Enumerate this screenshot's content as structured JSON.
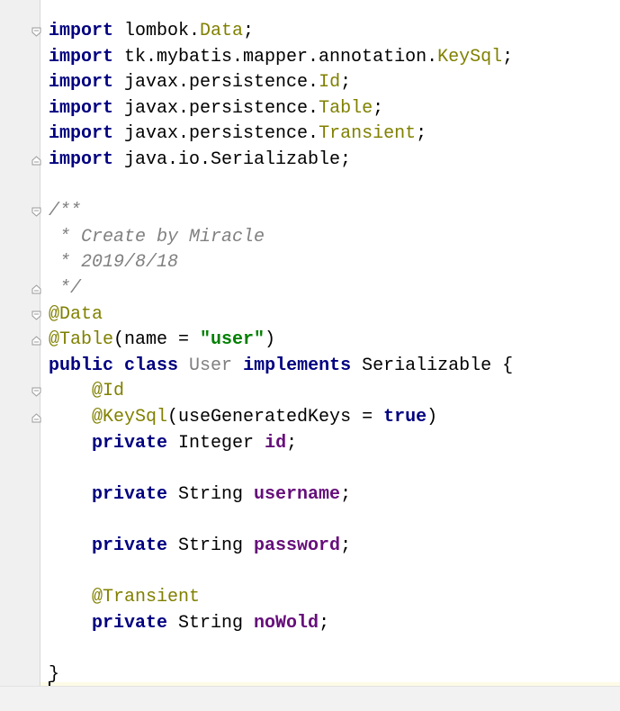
{
  "editor": {
    "lines": [
      [
        {
          "t": "import",
          "c": "kw"
        },
        {
          "t": " lombok."
        },
        {
          "t": "Data",
          "c": "cls"
        },
        {
          "t": ";"
        }
      ],
      [
        {
          "t": "import",
          "c": "kw"
        },
        {
          "t": " tk.mybatis.mapper.annotation."
        },
        {
          "t": "KeySql",
          "c": "cls"
        },
        {
          "t": ";"
        }
      ],
      [
        {
          "t": "import",
          "c": "kw"
        },
        {
          "t": " javax.persistence."
        },
        {
          "t": "Id",
          "c": "cls"
        },
        {
          "t": ";"
        }
      ],
      [
        {
          "t": "import",
          "c": "kw"
        },
        {
          "t": " javax.persistence."
        },
        {
          "t": "Table",
          "c": "cls"
        },
        {
          "t": ";"
        }
      ],
      [
        {
          "t": "import",
          "c": "kw"
        },
        {
          "t": " javax.persistence."
        },
        {
          "t": "Transient",
          "c": "cls"
        },
        {
          "t": ";"
        }
      ],
      [
        {
          "t": "import",
          "c": "kw"
        },
        {
          "t": " java.io.Serializable;"
        }
      ],
      [],
      [
        {
          "t": "/**",
          "c": "cmt"
        }
      ],
      [
        {
          "t": " * Create by Miracle",
          "c": "cmt"
        }
      ],
      [
        {
          "t": " * 2019/8/18",
          "c": "cmt"
        }
      ],
      [
        {
          "t": " */",
          "c": "cmt"
        }
      ],
      [
        {
          "t": "@Data",
          "c": "ann"
        }
      ],
      [
        {
          "t": "@Table",
          "c": "ann"
        },
        {
          "t": "(name = "
        },
        {
          "t": "\"user\"",
          "c": "str"
        },
        {
          "t": ")"
        }
      ],
      [
        {
          "t": "public class",
          "c": "kw"
        },
        {
          "t": " "
        },
        {
          "t": "User",
          "c": "gray"
        },
        {
          "t": " "
        },
        {
          "t": "implements",
          "c": "kw"
        },
        {
          "t": " Serializable {"
        }
      ],
      [
        {
          "t": "    "
        },
        {
          "t": "@Id",
          "c": "ann"
        }
      ],
      [
        {
          "t": "    "
        },
        {
          "t": "@KeySql",
          "c": "ann"
        },
        {
          "t": "(useGeneratedKeys = "
        },
        {
          "t": "true",
          "c": "kw"
        },
        {
          "t": ")"
        }
      ],
      [
        {
          "t": "    "
        },
        {
          "t": "private",
          "c": "kw"
        },
        {
          "t": " Integer "
        },
        {
          "t": "id",
          "c": "fld"
        },
        {
          "t": ";"
        }
      ],
      [],
      [
        {
          "t": "    "
        },
        {
          "t": "private",
          "c": "kw"
        },
        {
          "t": " String "
        },
        {
          "t": "username",
          "c": "fld"
        },
        {
          "t": ";"
        }
      ],
      [],
      [
        {
          "t": "    "
        },
        {
          "t": "private",
          "c": "kw"
        },
        {
          "t": " String "
        },
        {
          "t": "password",
          "c": "fld"
        },
        {
          "t": ";"
        }
      ],
      [],
      [
        {
          "t": "    "
        },
        {
          "t": "@Transient",
          "c": "ann"
        }
      ],
      [
        {
          "t": "    "
        },
        {
          "t": "private",
          "c": "kw"
        },
        {
          "t": " String "
        },
        {
          "t": "noWold",
          "c": "fld"
        },
        {
          "t": ";"
        }
      ],
      [],
      [
        {
          "t": "}"
        }
      ]
    ],
    "fold_markers": [
      {
        "line": 0,
        "dir": "open"
      },
      {
        "line": 5,
        "dir": "close"
      },
      {
        "line": 7,
        "dir": "open"
      },
      {
        "line": 10,
        "dir": "close"
      },
      {
        "line": 11,
        "dir": "open"
      },
      {
        "line": 12,
        "dir": "close"
      },
      {
        "line": 14,
        "dir": "open"
      },
      {
        "line": 15,
        "dir": "close"
      }
    ],
    "colors": {
      "keyword": "#000080",
      "annotation": "#808000",
      "string": "#008000",
      "comment": "#808080",
      "field": "#660e7a",
      "gutter": "#f0f0f0"
    }
  }
}
